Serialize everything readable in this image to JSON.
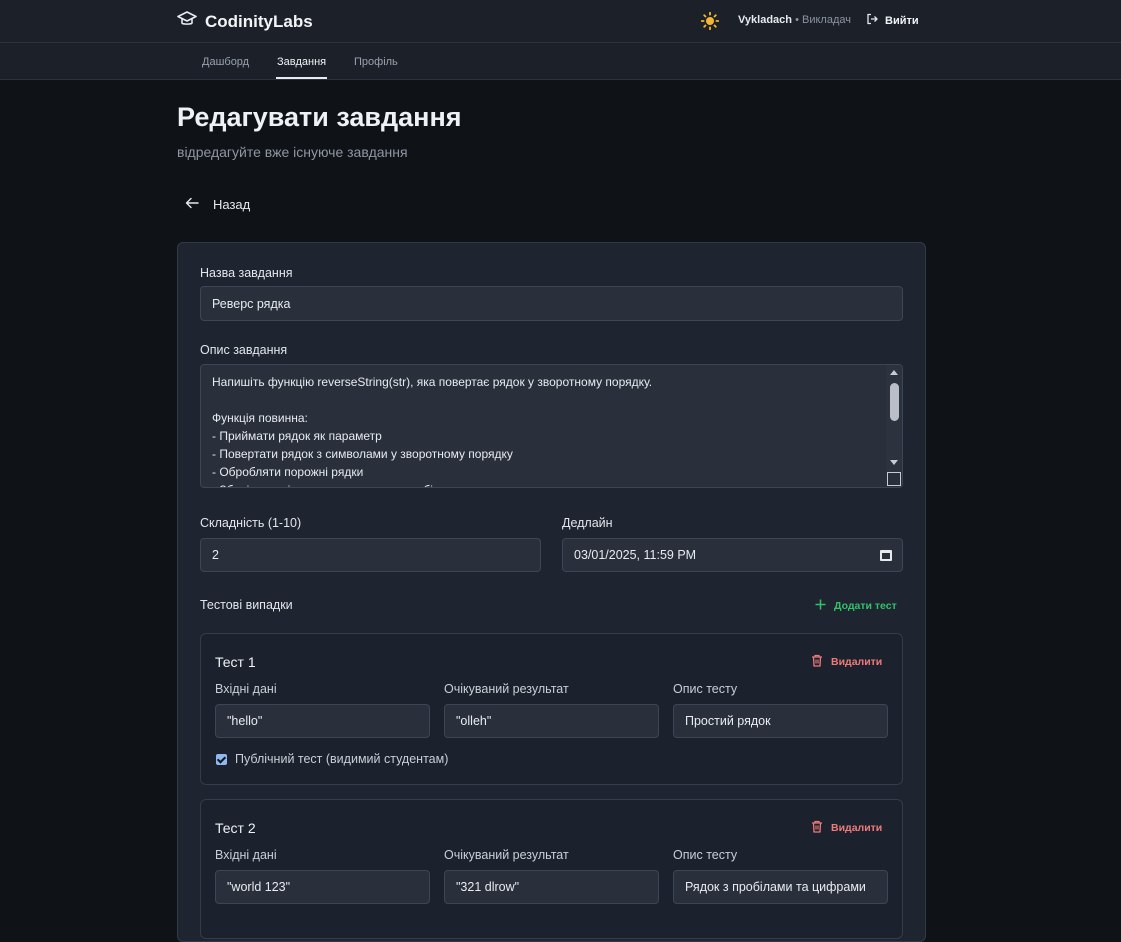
{
  "header": {
    "brand": "CodinityLabs",
    "user_name": "Vykladach",
    "user_role": "• Викладач",
    "logout_label": "Вийти"
  },
  "nav": {
    "items": [
      {
        "label": "Дашборд"
      },
      {
        "label": "Завдання",
        "active": true
      },
      {
        "label": "Профіль"
      }
    ]
  },
  "page": {
    "title": "Редагувати завдання",
    "subtitle": "відредагуйте вже існуюче завдання",
    "back_label": "Назад"
  },
  "form": {
    "name_label": "Назва завдання",
    "name_value": "Реверс рядка",
    "description_label": "Опис завдання",
    "description_value": "Напишіть функцію reverseString(str), яка повертає рядок у зворотному порядку.\n\nФункція повинна:\n- Приймати рядок як параметр\n- Повертати рядок з символами у зворотному порядку\n- Обробляти порожні рядки\n- Зберігати всі символи включно з пробілами",
    "difficulty_label": "Складність (1-10)",
    "difficulty_value": "2",
    "deadline_label": "Дедлайн",
    "deadline_value": "03/01/2025, 11:59 PM",
    "tests_label": "Тестові випадки",
    "add_test_label": "Додати тест"
  },
  "tests": [
    {
      "title": "Тест 1",
      "delete_label": "Видалити",
      "input_label": "Вхідні дані",
      "input_value": "\"hello\"",
      "expected_label": "Очікуваний результат",
      "expected_value": "\"olleh\"",
      "desc_label": "Опис тесту",
      "desc_value": "Простий рядок",
      "public_label": "Публічний тест (видимий студентам)",
      "public": true
    },
    {
      "title": "Тест 2",
      "delete_label": "Видалити",
      "input_label": "Вхідні дані",
      "input_value": "\"world 123\"",
      "expected_label": "Очікуваний результат",
      "expected_value": "\"321 dlrow\"",
      "desc_label": "Опис тесту",
      "desc_value": "Рядок з пробілами та цифрами"
    }
  ],
  "colors": {
    "accent_green": "#34c06a",
    "danger_red": "#f07a7a",
    "sun_yellow": "#f5b731"
  }
}
